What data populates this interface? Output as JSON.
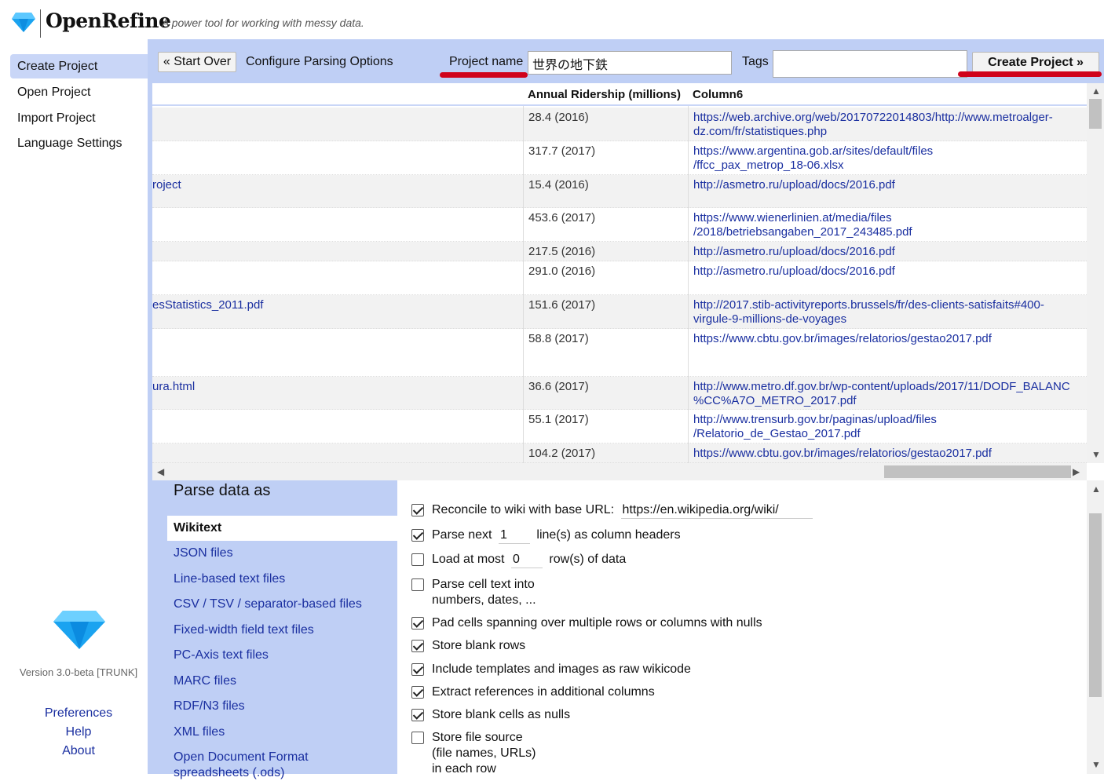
{
  "app": {
    "name": "OpenRefine",
    "tagline": "A power tool for working with messy data."
  },
  "nav": {
    "items": [
      "Create Project",
      "Open Project",
      "Import Project",
      "Language Settings"
    ],
    "active_index": 0,
    "version": "Version 3.0-beta [TRUNK]",
    "footer_links": [
      "Preferences",
      "Help",
      "About"
    ]
  },
  "toolbar": {
    "start_over": "« Start Over",
    "configure_label": "Configure Parsing Options",
    "project_name_label": "Project name",
    "project_name_value": "世界の地下鉄",
    "tags_label": "Tags",
    "tags_value": "",
    "create_project": "Create Project »"
  },
  "preview": {
    "columns": [
      "Annual Ridership (millions)",
      "Column6"
    ],
    "rows": [
      {
        "left": "",
        "ridership": "28.4 (2016)",
        "url": [
          "https://web.archive.org/web/20170722014803/http://www.metroalger-",
          "dz.com/fr/statistiques.php"
        ]
      },
      {
        "left": "",
        "ridership": "317.7 (2017)",
        "url": [
          "https://www.argentina.gob.ar/sites/default/files",
          "/ffcc_pax_metrop_18-06.xlsx"
        ]
      },
      {
        "left": "roject",
        "ridership": "15.4 (2016)",
        "url": [
          "http://asmetro.ru/upload/docs/2016.pdf"
        ]
      },
      {
        "left": "",
        "ridership": "453.6 (2017)",
        "url": [
          "https://www.wienerlinien.at/media/files",
          "/2018/betriebsangaben_2017_243485.pdf"
        ]
      },
      {
        "left": "",
        "ridership": "217.5 (2016)",
        "url": [
          "http://asmetro.ru/upload/docs/2016.pdf"
        ]
      },
      {
        "left": "",
        "ridership": "291.0 (2016)",
        "url": [
          "http://asmetro.ru/upload/docs/2016.pdf"
        ]
      },
      {
        "left": "esStatistics_2011.pdf",
        "ridership": "151.6 (2017)",
        "url": [
          "http://2017.stib-activityreports.brussels/fr/des-clients-satisfaits#400-",
          "virgule-9-millions-de-voyages"
        ]
      },
      {
        "left": "",
        "ridership": "58.8 (2017)",
        "url": [
          "https://www.cbtu.gov.br/images/relatorios/gestao2017.pdf"
        ]
      },
      {
        "left": "ura.html",
        "ridership": "36.6 (2017)",
        "url": [
          "http://www.metro.df.gov.br/wp-content/uploads/2017/11/DODF_BALANC",
          "%CC%A7O_METRO_2017.pdf"
        ]
      },
      {
        "left": "",
        "ridership": "55.1 (2017)",
        "url": [
          "http://www.trensurb.gov.br/paginas/upload/files",
          "/Relatorio_de_Gestao_2017.pdf"
        ]
      },
      {
        "left": "",
        "ridership": "104.2 (2017)",
        "url": [
          "https://www.cbtu.gov.br/images/relatorios/gestao2017.pdf"
        ]
      }
    ]
  },
  "parse": {
    "title": "Parse data as",
    "formats": [
      "Wikitext",
      "JSON files",
      "Line-based text files",
      "CSV / TSV / separator-based files",
      "Fixed-width field text files",
      "PC-Axis text files",
      "MARC files",
      "RDF/N3 files",
      "XML files",
      "Open Document Format",
      "spreadsheets (.ods)"
    ],
    "active_format": 0,
    "options": {
      "reconcile": {
        "label": "Reconcile to wiki with base URL:",
        "value": "https://en.wikipedia.org/wiki/",
        "checked": true
      },
      "parse_next": {
        "label_pre": "Parse next",
        "value": "1",
        "label_post": "line(s) as column headers",
        "checked": true
      },
      "load_at_most": {
        "label_pre": "Load at most",
        "value": "0",
        "label_post": "row(s) of data",
        "checked": false
      },
      "parse_cell": {
        "line1": "Parse cell text into",
        "line2": "numbers, dates, ...",
        "checked": false
      },
      "pad_cells": {
        "label": "Pad cells spanning over multiple rows or columns with nulls",
        "checked": true
      },
      "blank_rows": {
        "label": "Store blank rows",
        "checked": true
      },
      "templates": {
        "label": "Include templates and images as raw wikicode",
        "checked": true
      },
      "references": {
        "label": "Extract references in additional columns",
        "checked": true
      },
      "blank_cells": {
        "label": "Store blank cells as nulls",
        "checked": true
      },
      "file_source": {
        "line1": "Store file source",
        "line2": "(file names, URLs)",
        "line3": "in each row",
        "checked": false
      }
    }
  }
}
